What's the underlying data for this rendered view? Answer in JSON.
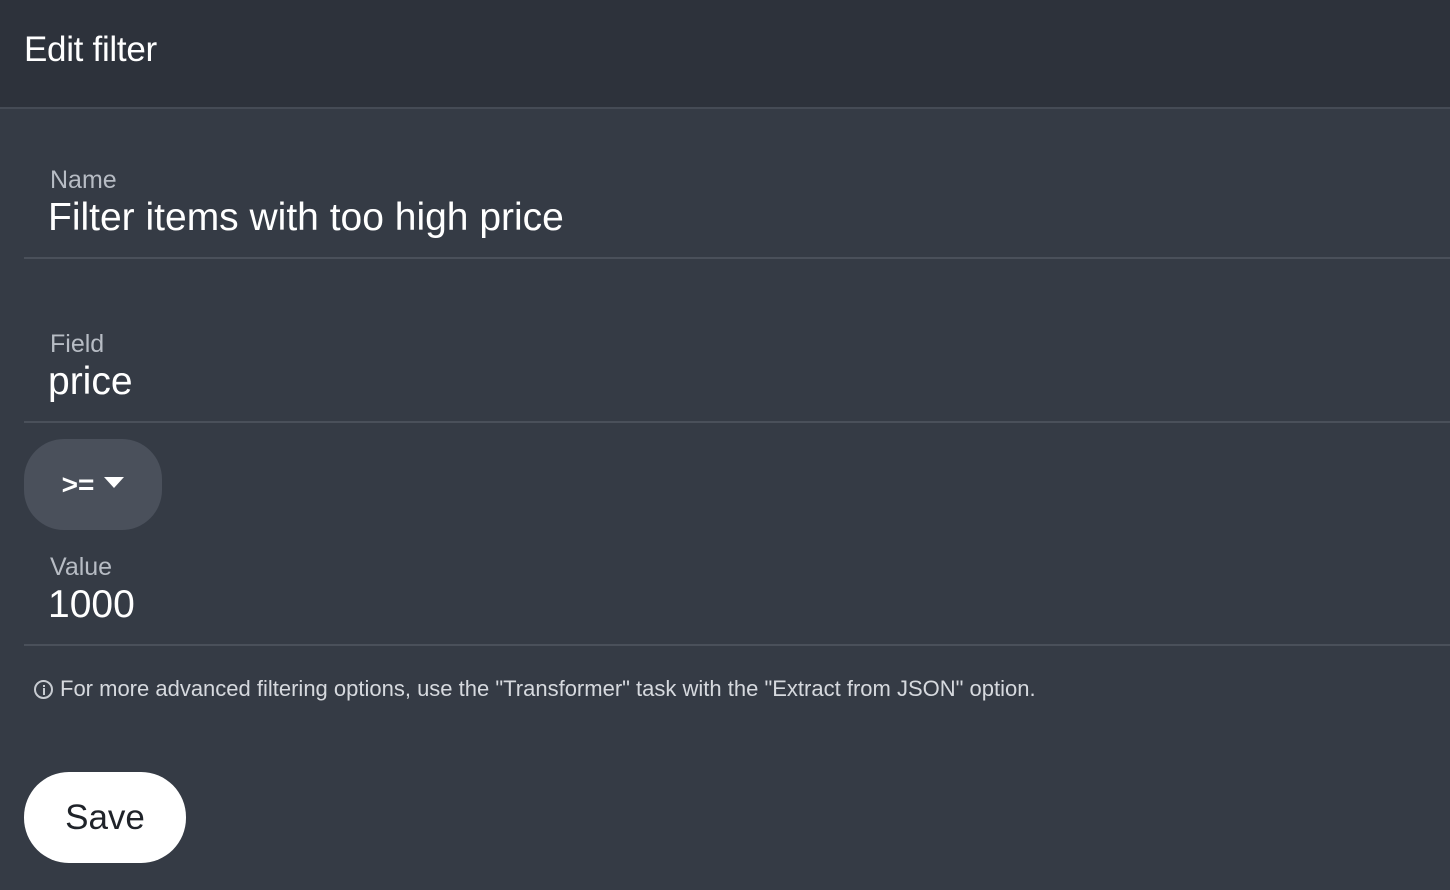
{
  "header": {
    "title": "Edit filter"
  },
  "form": {
    "name": {
      "label": "Name",
      "value": "Filter items with too high price"
    },
    "field": {
      "label": "Field",
      "value": "price"
    },
    "operator": {
      "selected": ">="
    },
    "value": {
      "label": "Value",
      "value": "1000"
    },
    "hint": "For more advanced filtering options, use the \"Transformer\" task with the \"Extract from JSON\" option.",
    "save_label": "Save"
  },
  "icons": {
    "hint_icon": "info-icon",
    "operator_icon": "caret-down-icon"
  },
  "colors": {
    "background": "#353b45",
    "header_background": "#2d323b",
    "operator_background": "#4a505b",
    "save_background": "#ffffff"
  }
}
